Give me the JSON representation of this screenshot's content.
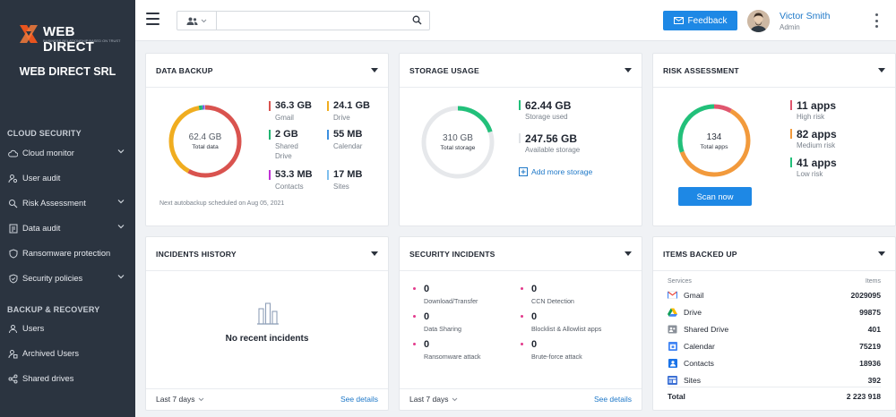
{
  "brand": {
    "logo_text": "WEB DIRECT",
    "tagline": "BUSINESS RELATIONSHIP BASED ON TRUST",
    "company": "WEB DIRECT SRL"
  },
  "sidebar": {
    "sections": [
      {
        "title": "CLOUD SECURITY",
        "items": [
          {
            "label": "Cloud monitor",
            "icon": "cloud-icon",
            "has_chevron": true
          },
          {
            "label": "User audit",
            "icon": "user-audit-icon",
            "has_chevron": false
          },
          {
            "label": "Risk Assessment",
            "icon": "risk-icon",
            "has_chevron": true
          },
          {
            "label": "Data audit",
            "icon": "data-audit-icon",
            "has_chevron": true
          },
          {
            "label": "Ransomware protection",
            "icon": "shield-icon",
            "has_chevron": false
          },
          {
            "label": "Security policies",
            "icon": "policy-icon",
            "has_chevron": true
          }
        ]
      },
      {
        "title": "BACKUP & RECOVERY",
        "items": [
          {
            "label": "Users",
            "icon": "users-icon",
            "has_chevron": false
          },
          {
            "label": "Archived Users",
            "icon": "archive-icon",
            "has_chevron": false
          },
          {
            "label": "Shared drives",
            "icon": "share-icon",
            "has_chevron": false
          }
        ]
      }
    ]
  },
  "topbar": {
    "search_value": "",
    "search_placeholder": "",
    "feedback_label": "Feedback",
    "user_name": "Victor Smith",
    "user_role": "Admin"
  },
  "cards": {
    "data_backup": {
      "title": "DATA BACKUP",
      "total_value": "62.4 GB",
      "total_label": "Total data",
      "stats": [
        {
          "value": "36.3 GB",
          "label": "Gmail",
          "color": "#d9534f",
          "fraction": 0.58
        },
        {
          "value": "24.1 GB",
          "label": "Drive",
          "color": "#f0ad20",
          "fraction": 0.39
        },
        {
          "value": "2 GB",
          "label": "Shared Drive",
          "color": "#22b573",
          "fraction": 0.015
        },
        {
          "value": "55 MB",
          "label": "Calendar",
          "color": "#3b8fe0",
          "fraction": 0.005
        },
        {
          "value": "53.3 MB",
          "label": "Contacts",
          "color": "#c032d6",
          "fraction": 0.005
        },
        {
          "value": "17 MB",
          "label": "Sites",
          "color": "#7fbfef",
          "fraction": 0.005
        }
      ],
      "footnote": "Next autobackup scheduled on Aug 05, 2021"
    },
    "storage_usage": {
      "title": "STORAGE USAGE",
      "total_value": "310 GB",
      "total_label": "Total storage",
      "used_value": "62.44 GB",
      "used_label": "Storage used",
      "available_value": "247.56 GB",
      "available_label": "Available storage",
      "add_label": "Add more storage",
      "used_fraction": 0.2,
      "used_color": "#22c07a",
      "track_color": "#e6e8eb"
    },
    "risk_assessment": {
      "title": "RISK ASSESSMENT",
      "total_value": "134",
      "total_label": "Total apps",
      "stats": [
        {
          "value": "11 apps",
          "label": "High risk",
          "color": "#e0566e",
          "fraction": 0.082
        },
        {
          "value": "82 apps",
          "label": "Medium risk",
          "color": "#f29a3c",
          "fraction": 0.612
        },
        {
          "value": "41 apps",
          "label": "Low risk",
          "color": "#22c07a",
          "fraction": 0.306
        }
      ],
      "scan_label": "Scan now"
    },
    "incidents_history": {
      "title": "INCIDENTS HISTORY",
      "empty_text": "No recent incidents",
      "period": "Last 7 days",
      "details": "See details"
    },
    "security_incidents": {
      "title": "SECURITY INCIDENTS",
      "items": [
        {
          "count": "0",
          "label": "Download/Transfer"
        },
        {
          "count": "0",
          "label": "CCN Detection"
        },
        {
          "count": "0",
          "label": "Data Sharing"
        },
        {
          "count": "0",
          "label": "Blocklist & Allowlist apps"
        },
        {
          "count": "0",
          "label": "Ransomware attack"
        },
        {
          "count": "0",
          "label": "Brute-force attack"
        }
      ],
      "period": "Last 7 days",
      "details": "See details"
    },
    "items_backed_up": {
      "title": "ITEMS BACKED UP",
      "col_services": "Services",
      "col_items": "Items",
      "rows": [
        {
          "service": "Gmail",
          "count": "2029095",
          "icon": "gmail-icon"
        },
        {
          "service": "Drive",
          "count": "99875",
          "icon": "drive-icon"
        },
        {
          "service": "Shared Drive",
          "count": "401",
          "icon": "shared-drive-icon"
        },
        {
          "service": "Calendar",
          "count": "75219",
          "icon": "calendar-icon"
        },
        {
          "service": "Contacts",
          "count": "18936",
          "icon": "contacts-icon"
        },
        {
          "service": "Sites",
          "count": "392",
          "icon": "sites-icon"
        }
      ],
      "total_label": "Total",
      "total_count": "2 223 918"
    }
  }
}
